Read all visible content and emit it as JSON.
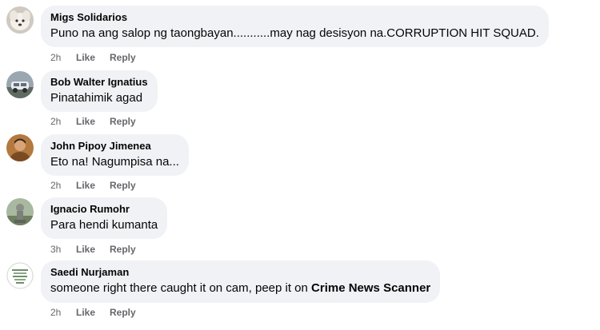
{
  "comments": [
    {
      "author": "Migs Solidarios",
      "text": "Puno na ang salop ng taongbayan...........may nag desisyon na.CORRUPTION HIT SQUAD.",
      "time": "2h",
      "like_label": "Like",
      "reply_label": "Reply",
      "avatar_icon": "white-dog-avatar"
    },
    {
      "author": "Bob Walter Ignatius",
      "text": "Pinatahimik agad",
      "time": "2h",
      "like_label": "Like",
      "reply_label": "Reply",
      "avatar_icon": "car-avatar"
    },
    {
      "author": "John Pipoy Jimenea",
      "text": "Eto na! Nagumpisa na...",
      "time": "2h",
      "like_label": "Like",
      "reply_label": "Reply",
      "avatar_icon": "person-avatar"
    },
    {
      "author": "Ignacio Rumohr",
      "text": "Para hendi kumanta",
      "time": "3h",
      "like_label": "Like",
      "reply_label": "Reply",
      "avatar_icon": "statue-avatar"
    },
    {
      "author": "Saedi Nurjaman",
      "text_prefix": "someone right there caught it on cam, peep it on ",
      "text_bold": "Crime News Scanner",
      "time": "2h",
      "like_label": "Like",
      "reply_label": "Reply",
      "avatar_icon": "logo-badge-avatar"
    }
  ],
  "colors": {
    "bubble": "#f0f2f5",
    "text": "#050505",
    "meta": "#65676b"
  }
}
